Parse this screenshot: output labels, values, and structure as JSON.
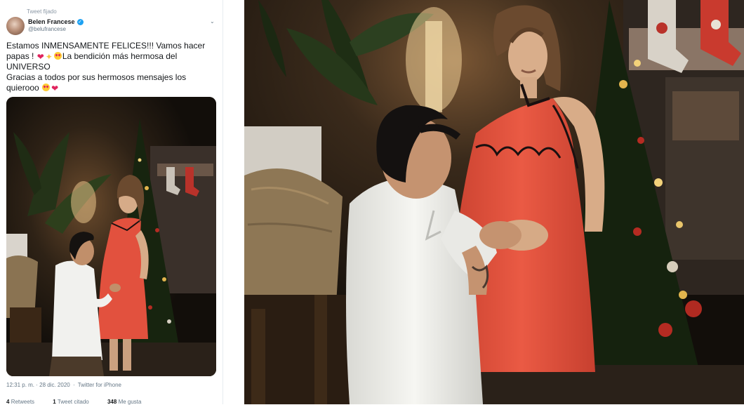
{
  "tweet": {
    "pinned_label": "Tweet fijado",
    "author_name": "Belen Francese",
    "author_handle": "@belufrancese",
    "more_icon": "chevron-down-icon",
    "text_line1": "Estamos INMENSAMENTE FELICES!!! Vamos hacer",
    "text_line2": "papas !",
    "text_line2b": "La bendición más hermosa del",
    "text_line3": "UNIVERSO",
    "text_line4": "Gracias a todos por sus hermosos mensajes los",
    "text_line5": "quierooo",
    "timestamp": "12:31 p. m. · 28 dic. 2020",
    "source": "Twitter for iPhone",
    "retweets_count": "4",
    "retweets_label": "Retweets",
    "quote_count": "1",
    "quote_label": "Tweet citado",
    "likes_count": "348",
    "likes_label": "Me gusta"
  },
  "colors": {
    "dress": "#e2513e",
    "shirt": "#f1f1ee",
    "twitter_blue": "#1da1f2",
    "heart": "#e0245e"
  }
}
